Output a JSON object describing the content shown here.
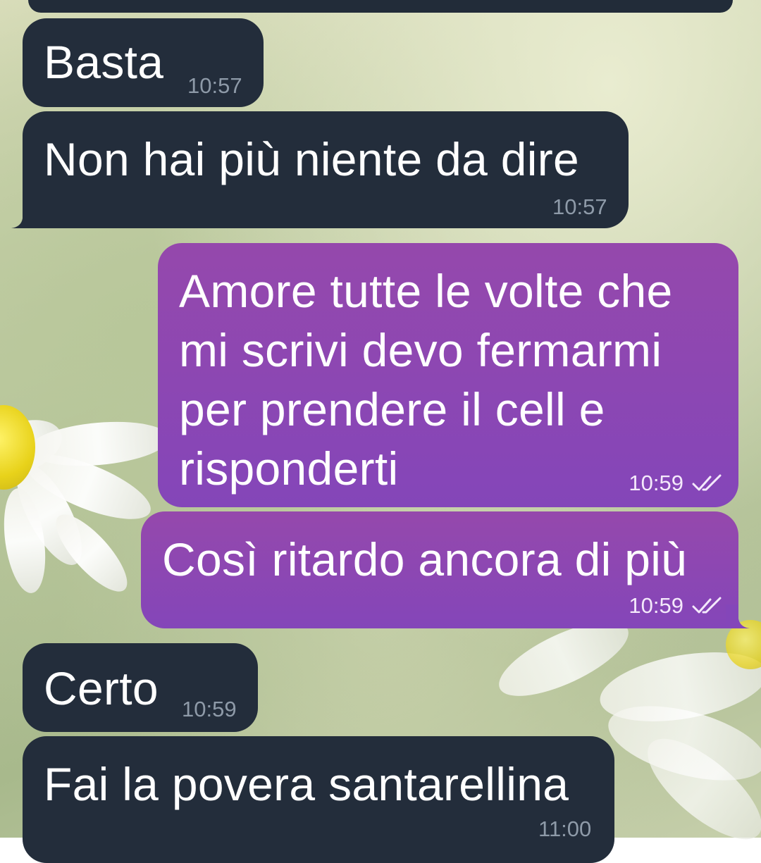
{
  "messages": [
    {
      "id": "m1",
      "direction": "incoming",
      "text": "Basta",
      "time": "10:57"
    },
    {
      "id": "m2",
      "direction": "incoming",
      "text": "Non hai più niente da dire",
      "time": "10:57"
    },
    {
      "id": "m3",
      "direction": "outgoing",
      "text": "Amore tutte le volte che\nmi scrivi devo fermarmi\nper prendere il cell e\nrisponderti",
      "time": "10:59",
      "status": "read-double-check-icon"
    },
    {
      "id": "m4",
      "direction": "outgoing",
      "text": "Così ritardo ancora di più",
      "time": "10:59",
      "status": "read-double-check-icon"
    },
    {
      "id": "m5",
      "direction": "incoming",
      "text": "Certo",
      "time": "10:59"
    },
    {
      "id": "m6",
      "direction": "incoming",
      "text": "Fai la povera santarellina",
      "time": "11:00"
    }
  ],
  "colors": {
    "incoming_bubble": "#232d3b",
    "outgoing_bubble": "#8a47b6",
    "incoming_time": "#8e9aa8",
    "outgoing_time": "#f4e9fb"
  }
}
